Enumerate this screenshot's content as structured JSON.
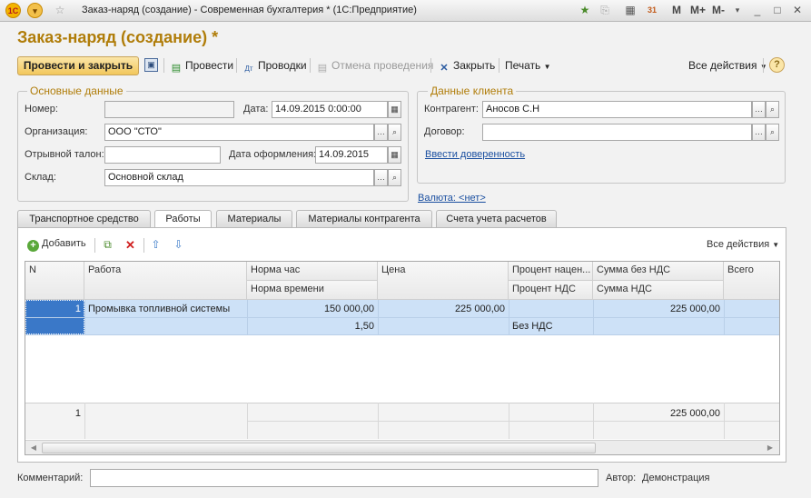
{
  "window": {
    "title": "Заказ-наряд (создание) - Современная бухгалтерия * (1С:Предприятие)",
    "logo_text": "1С",
    "mem_buttons": [
      "M",
      "M+",
      "M-"
    ],
    "win_controls": [
      "_",
      "□",
      "✕"
    ]
  },
  "form": {
    "title": "Заказ-наряд (создание) *"
  },
  "toolbar": {
    "post_close": "Провести и закрыть",
    "post": "Провести",
    "entries": "Проводки",
    "cancel_post": "Отмена проведения",
    "close": "Закрыть",
    "print": "Печать",
    "all_actions": "Все действия",
    "help": "?"
  },
  "main_group": {
    "title": "Основные данные",
    "number_label": "Номер:",
    "number_value": "",
    "date_label": "Дата:",
    "date_value": "14.09.2015  0:00:00",
    "org_label": "Организация:",
    "org_value": "ООО \"СТО\"",
    "ticket_label": "Отрывной талон:",
    "ticket_value": "",
    "reg_date_label": "Дата оформления:",
    "reg_date_value": "14.09.2015",
    "warehouse_label": "Склад:",
    "warehouse_value": "Основной склад"
  },
  "client_group": {
    "title": "Данные клиента",
    "counterparty_label": "Контрагент:",
    "counterparty_value": "Аносов С.Н",
    "contract_label": "Договор:",
    "contract_value": "",
    "proxy_link": "Ввести доверенность"
  },
  "currency_link": "Валюта: <нет>",
  "tabs": [
    "Транспортное средство",
    "Работы",
    "Материалы",
    "Материалы контрагента",
    "Счета учета расчетов"
  ],
  "table_toolbar": {
    "add": "Добавить",
    "all_actions": "Все действия"
  },
  "table": {
    "headers_row1": [
      "N",
      "Работа",
      "Норма час",
      "Цена",
      "Процент нацен...",
      "Сумма без НДС",
      "Всего"
    ],
    "headers_row2": [
      "Норма времени",
      "Процент НДС",
      "Сумма НДС"
    ],
    "rows": [
      {
        "n": "1",
        "work": "Промывка топливной системы",
        "norm_hour": "150 000,00",
        "norm_time": "1,50",
        "price": "225 000,00",
        "markup": "",
        "vat_percent": "Без НДС",
        "sum_no_vat": "225 000,00",
        "vat_sum": "",
        "total": ""
      }
    ],
    "footer": {
      "n": "1",
      "sum_no_vat": "225 000,00"
    }
  },
  "comment": {
    "label": "Комментарий:",
    "value": ""
  },
  "author": {
    "label": "Автор:",
    "value": "Демонстрация"
  }
}
